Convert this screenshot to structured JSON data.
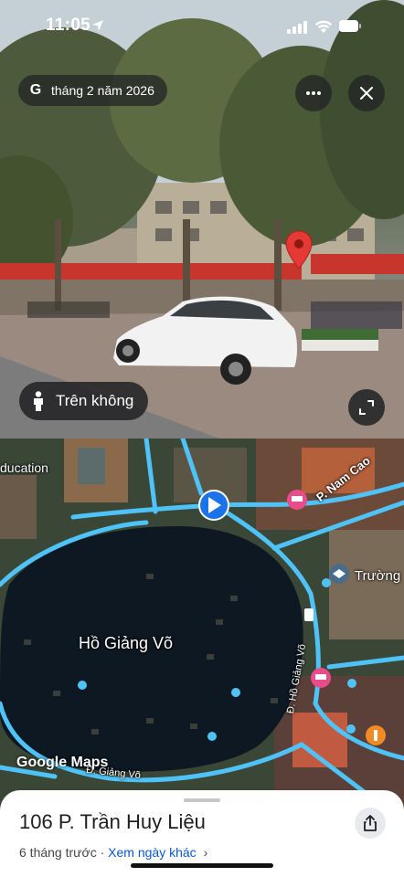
{
  "status_bar": {
    "time": "11:05"
  },
  "street_view": {
    "date_label": "tháng 2 năm 2026",
    "overhead_label": "Trên không"
  },
  "map": {
    "lake_label": "Hồ Giảng Võ",
    "education_label": "ducation",
    "street_nam_cao": "P. Nam Cao",
    "school_label": "Trường",
    "street_giang_vo_vertical": "Đ. Hồ Giảng Võ",
    "street_giang_vo_bottom": "Đ. Giảng Võ",
    "logo": "Google Maps"
  },
  "sheet": {
    "address": "106 P. Trần Huy Liệu",
    "age": "6 tháng trước",
    "separator": " · ",
    "other_dates_link": "Xem ngày khác",
    "chevron": "›"
  }
}
